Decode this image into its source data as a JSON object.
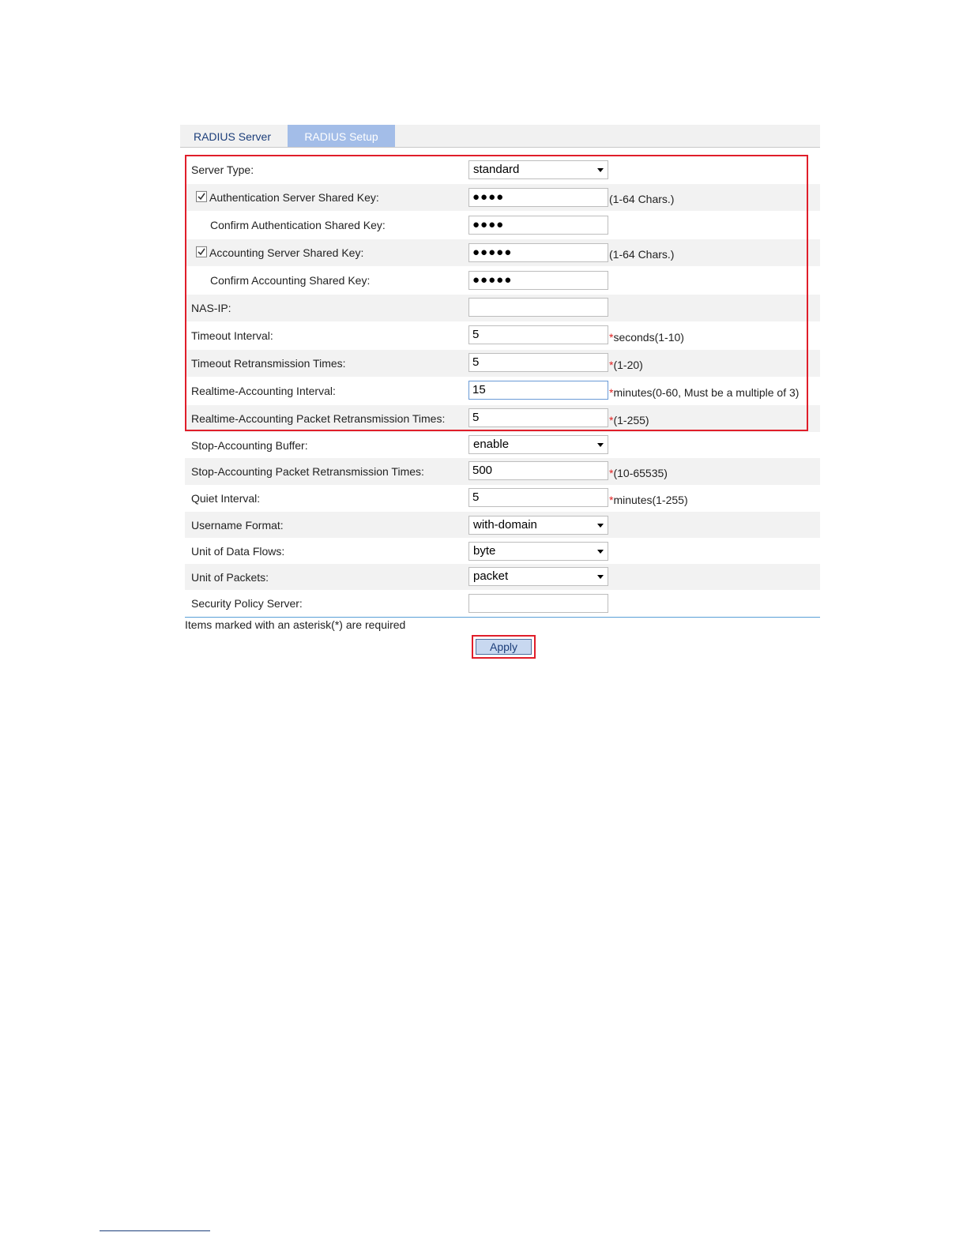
{
  "tabs": [
    {
      "label": "RADIUS Server"
    },
    {
      "label": "RADIUS Setup"
    }
  ],
  "form": {
    "server_type": {
      "label": "Server Type:",
      "value": "standard"
    },
    "auth_key": {
      "label": "Authentication Server Shared Key:",
      "value": "●●●●",
      "hint": "(1-64 Chars.)",
      "checked": true
    },
    "confirm_auth_key": {
      "label": "Confirm Authentication Shared Key:",
      "value": "●●●●"
    },
    "acct_key": {
      "label": "Accounting Server Shared Key:",
      "value": "●●●●●",
      "hint": "(1-64 Chars.)",
      "checked": true
    },
    "confirm_acct_key": {
      "label": "Confirm Accounting Shared Key:",
      "value": "●●●●●"
    },
    "nas_ip": {
      "label": "NAS-IP:",
      "value": ""
    },
    "timeout_interval": {
      "label": "Timeout Interval:",
      "value": "5",
      "hint": "seconds(1-10)"
    },
    "timeout_retrans": {
      "label": "Timeout Retransmission Times:",
      "value": "5",
      "hint": "(1-20)"
    },
    "rt_acct_interval": {
      "label": "Realtime-Accounting Interval:",
      "value": "15",
      "hint": "minutes(0-60, Must be a multiple of 3)"
    },
    "rt_acct_retrans": {
      "label": "Realtime-Accounting Packet Retransmission Times:",
      "value": "5",
      "hint": "(1-255)"
    },
    "stop_acct_buffer": {
      "label": "Stop-Accounting Buffer:",
      "value": "enable"
    },
    "stop_acct_retrans": {
      "label": "Stop-Accounting Packet Retransmission Times:",
      "value": "500",
      "hint": "(10-65535)"
    },
    "quiet_interval": {
      "label": "Quiet Interval:",
      "value": "5",
      "hint": "minutes(1-255)"
    },
    "username_format": {
      "label": "Username Format:",
      "value": "with-domain"
    },
    "unit_data_flows": {
      "label": "Unit of Data Flows:",
      "value": "byte"
    },
    "unit_packets": {
      "label": "Unit of Packets:",
      "value": "packet"
    },
    "security_policy_server": {
      "label": "Security Policy Server:",
      "value": ""
    }
  },
  "required_asterisk": "*",
  "note": "Items marked with an asterisk(*) are required",
  "apply_label": "Apply",
  "colors": {
    "highlight_box": "#e01e2a",
    "tab_active": "#a3bde8",
    "asterisk": "#e02020"
  }
}
